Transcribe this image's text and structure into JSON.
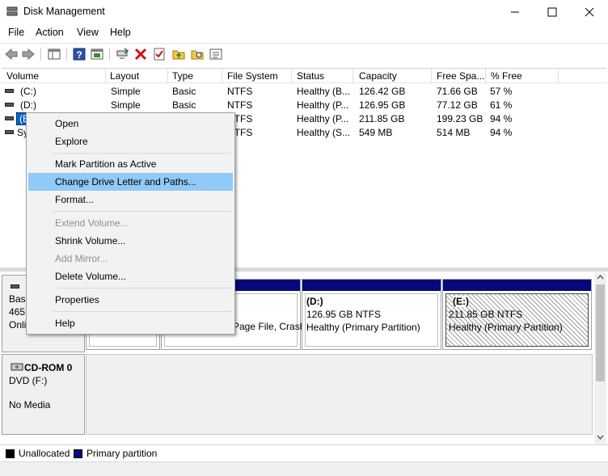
{
  "window": {
    "title": "Disk Management",
    "minimize_icon": "minimize-icon",
    "maximize_icon": "maximize-icon",
    "close_icon": "close-icon"
  },
  "menu": [
    "File",
    "Action",
    "View",
    "Help"
  ],
  "toolbar": {
    "icons": [
      "back-arrow-icon",
      "forward-arrow-icon",
      "console-tree-icon",
      "help-icon",
      "properties-icon",
      "connect-icon",
      "delete-icon",
      "check-icon",
      "up-folder-icon",
      "search-icon",
      "settings-list-icon"
    ]
  },
  "volumes": {
    "headers": [
      "Volume",
      "Layout",
      "Type",
      "File System",
      "Status",
      "Capacity",
      "Free Spa...",
      "% Free"
    ],
    "rows": [
      {
        "volume": "(C:)",
        "layout": "Simple",
        "type": "Basic",
        "fs": "NTFS",
        "status": "Healthy (B...",
        "capacity": "126.42 GB",
        "free": "71.66 GB",
        "pct": "57 %"
      },
      {
        "volume": "(D:)",
        "layout": "Simple",
        "type": "Basic",
        "fs": "NTFS",
        "status": "Healthy (P...",
        "capacity": "126.95 GB",
        "free": "77.12 GB",
        "pct": "61 %"
      },
      {
        "volume": "(E",
        "layout": "",
        "type": "",
        "fs": "NTFS",
        "status": "Healthy (P...",
        "capacity": "211.85 GB",
        "free": "199.23 GB",
        "pct": "94 %"
      },
      {
        "volume": "Sy",
        "layout": "",
        "type": "",
        "fs": "NTFS",
        "status": "Healthy (S...",
        "capacity": "549 MB",
        "free": "514 MB",
        "pct": "94 %"
      }
    ]
  },
  "disk0": {
    "line1": "Basi",
    "line2": "465.",
    "line3": "Onli"
  },
  "partitions": {
    "c": {
      "line1": "Page File, Crash"
    },
    "d": {
      "title": "(D:)",
      "line1": "126.95 GB NTFS",
      "line2": "Healthy (Primary Partition)"
    },
    "e": {
      "title": "(E:)",
      "line1": "211.85 GB NTFS",
      "line2": "Healthy (Primary Partition)"
    }
  },
  "cdrom": {
    "title": "CD-ROM 0",
    "line1": "DVD (F:)",
    "line2": "No Media"
  },
  "legend": {
    "unallocated": "Unallocated",
    "primary": "Primary partition",
    "unallocated_color": "#000000",
    "primary_color": "#08087e"
  },
  "context_menu": {
    "items": [
      {
        "label": "Open",
        "enabled": true
      },
      {
        "label": "Explore",
        "enabled": true
      },
      {
        "label": "Mark Partition as Active",
        "enabled": true
      },
      {
        "label": "Change Drive Letter and Paths...",
        "enabled": true,
        "highlighted": true
      },
      {
        "label": "Format...",
        "enabled": true
      },
      {
        "label": "Extend Volume...",
        "enabled": false
      },
      {
        "label": "Shrink Volume...",
        "enabled": true
      },
      {
        "label": "Add Mirror...",
        "enabled": false
      },
      {
        "label": "Delete Volume...",
        "enabled": true
      },
      {
        "label": "Properties",
        "enabled": true
      },
      {
        "label": "Help",
        "enabled": true
      }
    ]
  }
}
